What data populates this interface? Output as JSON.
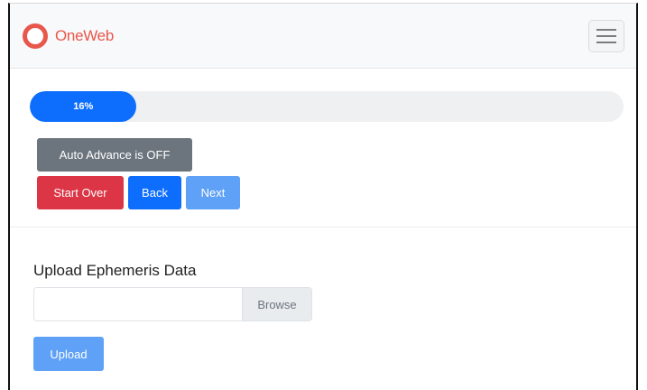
{
  "navbar": {
    "brand_name": "OneWeb",
    "logo_icon": "circle-ring-icon",
    "menu_icon": "hamburger-menu-icon"
  },
  "progress": {
    "value_percent": 16,
    "label": "16%"
  },
  "controls": {
    "auto_advance_label": "Auto Advance is OFF",
    "start_over_label": "Start Over",
    "back_label": "Back",
    "next_label": "Next"
  },
  "upload": {
    "title": "Upload Ephemeris Data",
    "file_value": "",
    "browse_label": "Browse",
    "upload_label": "Upload"
  },
  "colors": {
    "brand": "#e8574b",
    "primary": "#0d6efd",
    "primary_disabled": "#5fa1f6",
    "secondary": "#6c757d",
    "danger": "#dc3545"
  }
}
